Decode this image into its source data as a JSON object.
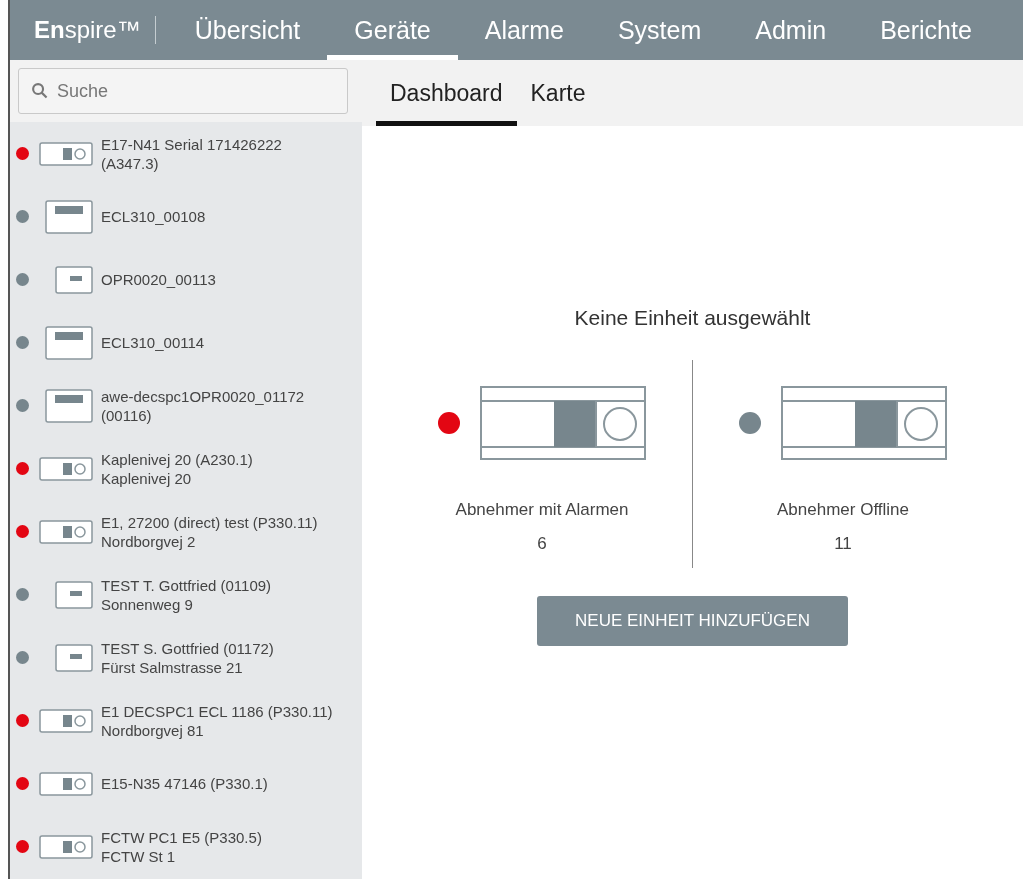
{
  "top_nav": {
    "logo": "**En**spire™",
    "items": [
      {
        "label": "Übersicht",
        "selected": false
      },
      {
        "label": "Geräte",
        "selected": true
      },
      {
        "label": "Alarme",
        "selected": false
      },
      {
        "label": "System",
        "selected": false
      },
      {
        "label": "Admin",
        "selected": false
      },
      {
        "label": "Berichte",
        "selected": false
      }
    ]
  },
  "sidebar": {
    "search": {
      "placeholder": "Suche"
    },
    "items": [
      {
        "kind": "switch",
        "color": "#e30613",
        "title": "E17-N41 Serial 171426222 (A347.3)"
      },
      {
        "kind": "display",
        "color": "#77868d",
        "title": "ECL310_00108"
      },
      {
        "kind": "small",
        "color": "#77868d",
        "title": "OPR0020_00113"
      },
      {
        "kind": "display",
        "color": "#77868d",
        "title": "ECL310_00114"
      },
      {
        "kind": "display",
        "color": "#77868d",
        "title": "awe-decspc1OPR0020_01172 (00116)"
      },
      {
        "kind": "switch",
        "color": "#e30613",
        "title": "Kaplenivej 20 (A230.1)",
        "subtitle": "Kaplenivej 20"
      },
      {
        "kind": "switch",
        "color": "#e30613",
        "title": "E1, 27200 (direct) test (P330.11)",
        "subtitle": "Nordborgvej 2"
      },
      {
        "kind": "small",
        "color": "#77868d",
        "title": "TEST T. Gottfried (01109)",
        "subtitle": "Sonnenweg 9"
      },
      {
        "kind": "small",
        "color": "#77868d",
        "title": "TEST S. Gottfried (01172)",
        "subtitle": "Fürst Salmstrasse 21"
      },
      {
        "kind": "switch",
        "color": "#e30613",
        "title": "E1 DECSPC1 ECL 1186 (P330.11)",
        "subtitle": "Nordborgvej 81"
      },
      {
        "kind": "switch",
        "color": "#e30613",
        "title": "E15-N35 47146 (P330.1)"
      },
      {
        "kind": "switch",
        "color": "#e30613",
        "title": "FCTW PC1 E5 (P330.5)",
        "subtitle": "FCTW St 1"
      }
    ]
  },
  "sub_tabs": [
    {
      "label": "Dashboard",
      "selected": true
    },
    {
      "label": "Karte",
      "selected": false
    }
  ],
  "dashboard": {
    "heading": "Keine Einheit ausgewählt",
    "cards": [
      {
        "color": "#e30613",
        "label": "Abnehmer mit Alarmen",
        "count": "6"
      },
      {
        "color": "#77868d",
        "label": "Abnehmer Offline",
        "count": "11"
      }
    ],
    "button": "NEUE EINHEIT HINZUFÜGEN"
  }
}
